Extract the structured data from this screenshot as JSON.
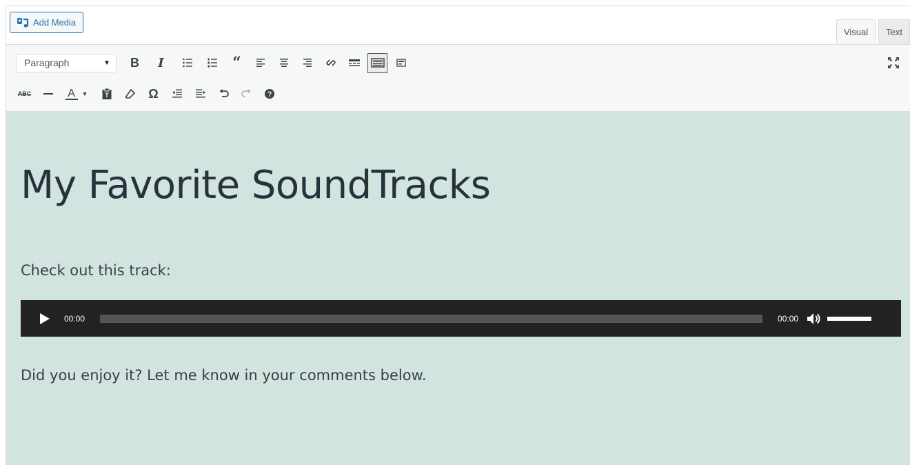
{
  "top": {
    "add_media_label": "Add Media",
    "tabs": [
      {
        "label": "Visual",
        "active": true
      },
      {
        "label": "Text",
        "active": false
      }
    ]
  },
  "toolbar": {
    "format_select": "Paragraph",
    "row1_icons": [
      "bold-icon",
      "italic-icon",
      "bulleted-list-icon",
      "numbered-list-icon",
      "blockquote-icon",
      "align-left-icon",
      "align-center-icon",
      "align-right-icon",
      "link-icon",
      "read-more-icon",
      "toolbar-toggle-icon",
      "insert-media-block-icon"
    ],
    "row2_icons": [
      "strikethrough-icon",
      "horizontal-line-icon",
      "text-color-icon",
      "paste-text-icon",
      "clear-formatting-icon",
      "special-character-icon",
      "outdent-icon",
      "indent-icon",
      "undo-icon",
      "redo-icon",
      "help-icon"
    ],
    "fullscreen_icon": "fullscreen-icon",
    "bold_glyph": "B",
    "italic_glyph": "I",
    "text_color_glyph": "A",
    "omega_glyph": "Ω",
    "strike_glyph": "ABC"
  },
  "content": {
    "heading": "My Favorite SoundTracks",
    "paragraph1": "Check out this track:",
    "paragraph2": "Did you enjoy it? Let me know in your comments below.",
    "player": {
      "current_time": "00:00",
      "duration": "00:00",
      "progress": 0,
      "volume": 1.0
    }
  },
  "colors": {
    "content_bg": "#d2e4df",
    "player_bg": "#222222",
    "accent": "#2271b1"
  }
}
